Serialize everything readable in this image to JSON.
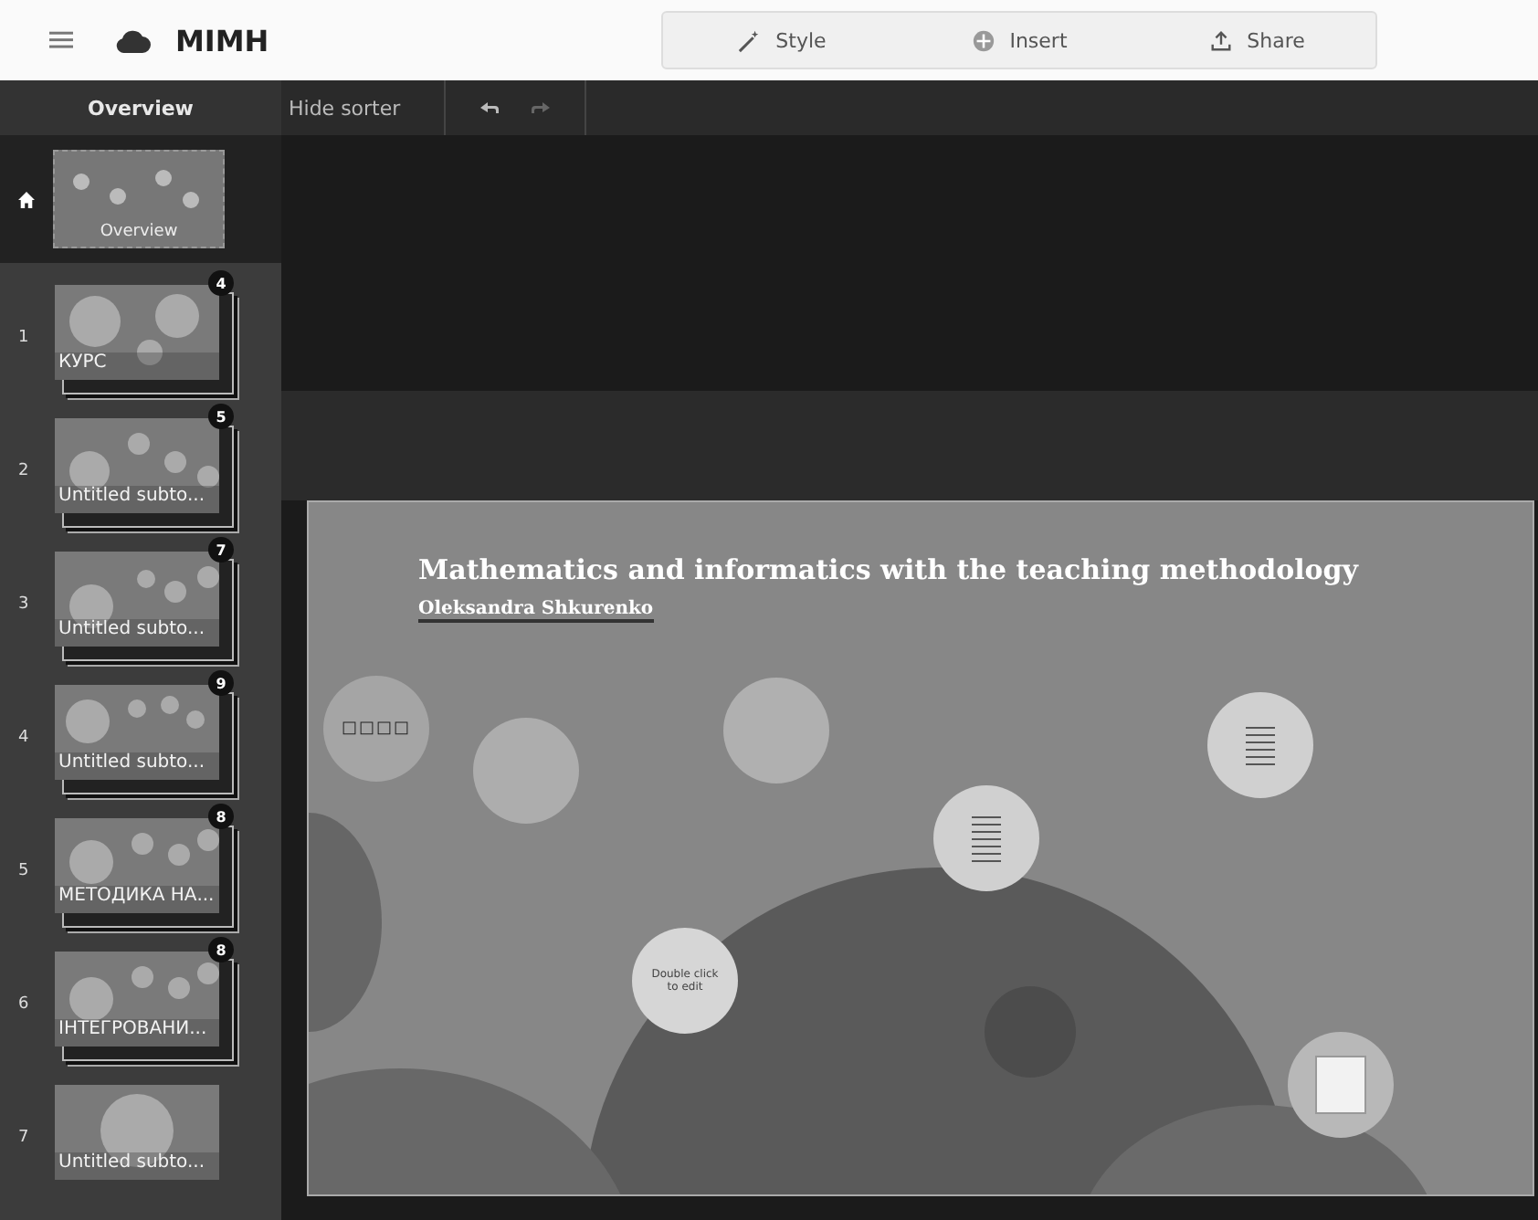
{
  "header": {
    "title": "MIMH",
    "actions": [
      {
        "kind": "style",
        "label": "Style"
      },
      {
        "kind": "insert",
        "label": "Insert"
      },
      {
        "kind": "share",
        "label": "Share"
      }
    ]
  },
  "toolbar": {
    "tabs": [
      {
        "label": "Overview",
        "selected": true
      },
      {
        "label": "Hide sorter",
        "selected": false
      }
    ]
  },
  "overview": {
    "label": "Overview"
  },
  "slides": [
    {
      "number": "1",
      "label": "КУРС",
      "badge": "4"
    },
    {
      "number": "2",
      "label": "Untitled subto...",
      "badge": "5"
    },
    {
      "number": "3",
      "label": "Untitled subto...",
      "badge": "7"
    },
    {
      "number": "4",
      "label": "Untitled subto...",
      "badge": "9"
    },
    {
      "number": "5",
      "label": "МЕТОДИКА НА...",
      "badge": "8"
    },
    {
      "number": "6",
      "label": "ІНТЕГРОВАНИ...",
      "badge": "8"
    },
    {
      "number": "7",
      "label": "Untitled subto..."
    }
  ],
  "canvas": {
    "title": "Mathematics and informatics with the teaching methodology",
    "author": "Oleksandra Shkurenko",
    "topic_text": "□□□□",
    "placeholder_text": "Double click to edit"
  }
}
